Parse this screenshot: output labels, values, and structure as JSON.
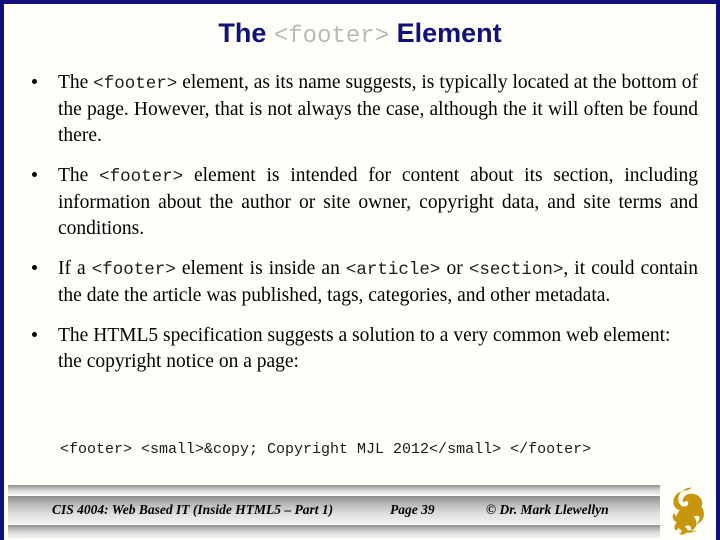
{
  "slide": {
    "title_prefix": "The",
    "title_code": "<footer>",
    "title_suffix": "Element",
    "border_color": "#12107a",
    "background_color": "#fffffa",
    "title_color": "#12107a",
    "title_code_color": "#b9b9b9"
  },
  "bullets": [
    {
      "id": "bullet-1",
      "parts": [
        {
          "type": "text",
          "value": "The "
        },
        {
          "type": "code",
          "value": "<footer>"
        },
        {
          "type": "text",
          "value": " element, as its name suggests, is typically located at the bottom of the page.  However, that is not always the case, although the it will often be found there."
        }
      ]
    },
    {
      "id": "bullet-2",
      "parts": [
        {
          "type": "text",
          "value": "The "
        },
        {
          "type": "code",
          "value": "<footer>"
        },
        {
          "type": "text",
          "value": " element is intended for content about its section, including information about the author or site owner, copyright data, and site terms and conditions."
        }
      ]
    },
    {
      "id": "bullet-3",
      "parts": [
        {
          "type": "text",
          "value": "If a "
        },
        {
          "type": "code",
          "value": "<footer>"
        },
        {
          "type": "text",
          "value": " element is inside an "
        },
        {
          "type": "code",
          "value": "<article>"
        },
        {
          "type": "text",
          "value": " or "
        },
        {
          "type": "code",
          "value": "<section>"
        },
        {
          "type": "text",
          "value": ", it could contain the date the article was published, tags, categories, and other metadata."
        }
      ]
    },
    {
      "id": "bullet-4",
      "parts": [
        {
          "type": "text",
          "value": "The HTML5 specification suggests a solution to a very common web element: the copyright notice on a page:"
        }
      ]
    }
  ],
  "code_sample": "<footer> <small>&copy; Copyright MJL 2012</small> </footer>",
  "footer": {
    "course": "CIS 4004: Web Based IT (Inside HTML5 – Part 1)",
    "page": "Page 39",
    "copyright": "© Dr. Mark Llewellyn",
    "logo_name": "ucf-pegasus-logo",
    "logo_color": "#c8960c"
  }
}
